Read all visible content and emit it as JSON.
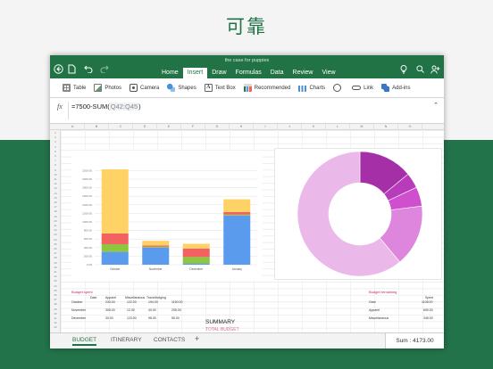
{
  "headline": "可靠",
  "app": {
    "doc_title": "the case for puppies",
    "tabs": [
      "Home",
      "Insert",
      "Draw",
      "Formulas",
      "Data",
      "Review",
      "View"
    ],
    "active_tab": "Insert"
  },
  "toolbar": {
    "table": "Table",
    "photos": "Photos",
    "camera": "Camera",
    "shapes": "Shapes",
    "textbox": "Text Box",
    "recommended": "Recommended",
    "charts": "Charts",
    "link": "Link",
    "addins": "Add-ins"
  },
  "formula_bar": {
    "fx": "fx",
    "prefix": "=7500-SUM(",
    "ref": "Q42:Q45",
    "suffix": ")"
  },
  "sheet": {
    "columns": [
      "A",
      "B",
      "C",
      "D",
      "E",
      "F",
      "G",
      "H",
      "I",
      "J",
      "K",
      "L",
      "M",
      "N",
      "O",
      "P",
      "Q",
      "R",
      "S",
      "T",
      "U",
      "V",
      "W"
    ],
    "rows": [
      "1",
      "2",
      "3",
      "4",
      "5",
      "6",
      "7",
      "8",
      "9",
      "10",
      "11",
      "12",
      "13",
      "14",
      "15",
      "16",
      "17",
      "18",
      "19",
      "20",
      "21",
      "22",
      "23",
      "24",
      "25",
      "26",
      "27",
      "28",
      "29",
      "30",
      "31",
      "32",
      "33",
      "34",
      "35",
      "36",
      "37",
      "38",
      "39",
      "40",
      "41",
      "42",
      "43",
      "44"
    ]
  },
  "budget_spent": {
    "title": "Budget spent",
    "headers": [
      "Date",
      "Apparel",
      "Miscellaneous",
      "Travel/lodging"
    ],
    "rows": [
      [
        "October",
        "233.00",
        "122.00",
        "194.00",
        "1150.00"
      ],
      [
        "November",
        "305.00",
        "12.00",
        "40.00",
        "205.00"
      ],
      [
        "December",
        "30.00",
        "123.00",
        "98.00",
        "55.00"
      ]
    ]
  },
  "budget_remaining": {
    "title": "Budget remaining",
    "header": "Spent",
    "rows": [
      [
        "Gear",
        "1108.00"
      ],
      [
        "Apparel",
        "690.00"
      ],
      [
        "Miscellaneous",
        "345.00"
      ]
    ]
  },
  "summary": {
    "title": "SUMMARY",
    "total_budget": "TOTAL BUDGET"
  },
  "sheet_tabs": [
    "BUDGET",
    "ITINERARY",
    "CONTACTS"
  ],
  "add_tab": "+",
  "status": {
    "sum": "Sum : 4173.00"
  },
  "chart_data": [
    {
      "type": "bar",
      "stacked": true,
      "categories": [
        "October",
        "November",
        "December",
        "January"
      ],
      "series": [
        {
          "color": "#5b9bee",
          "values": [
            300,
            400,
            30,
            1150
          ]
        },
        {
          "color": "#8dc63f",
          "values": [
            180,
            20,
            150,
            20
          ]
        },
        {
          "color": "#f36161",
          "values": [
            250,
            30,
            200,
            60
          ]
        },
        {
          "color": "#ffd266",
          "values": [
            1500,
            110,
            110,
            300
          ]
        }
      ],
      "ylim": [
        0,
        2500
      ],
      "y_ticks": [
        "0.00",
        "200.00",
        "400.00",
        "600.00",
        "800.00",
        "1000.00",
        "1200.00",
        "1400.00",
        "1600.00",
        "1800.00",
        "2000.00",
        "2200.00"
      ],
      "grid": true
    },
    {
      "type": "pie",
      "donut": true,
      "slices": [
        {
          "value": 14,
          "color": "#a52fa6"
        },
        {
          "value": 4,
          "color": "#b83bbb"
        },
        {
          "value": 5,
          "color": "#cf4fcf"
        },
        {
          "value": 16,
          "color": "#de86de"
        },
        {
          "value": 61,
          "color": "#eab9ea"
        }
      ]
    }
  ]
}
